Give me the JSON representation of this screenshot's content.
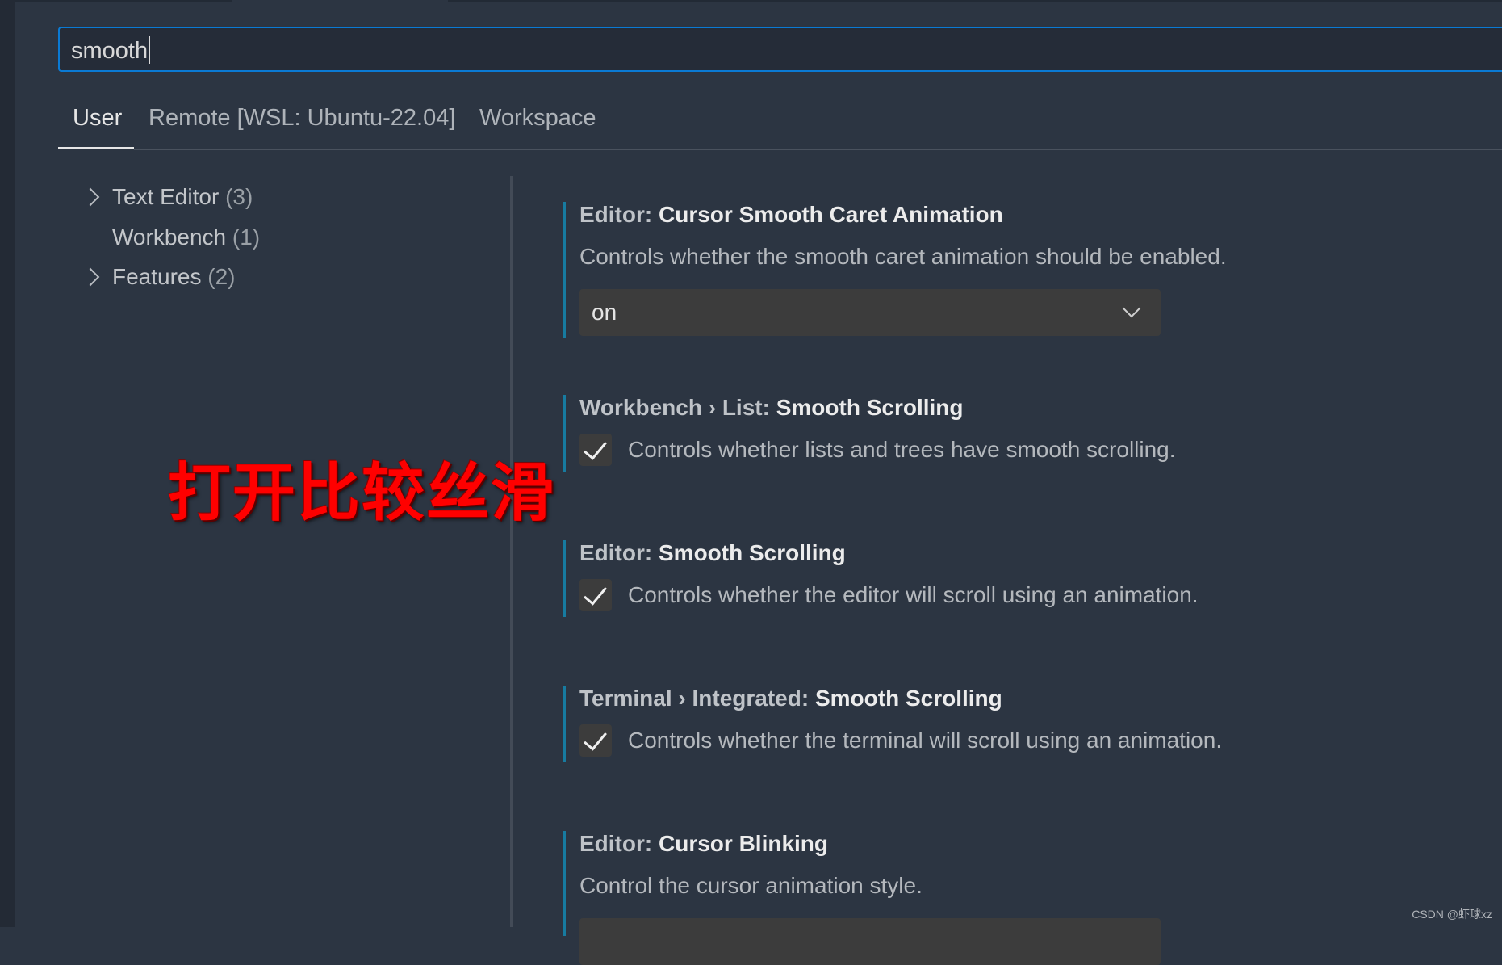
{
  "search": {
    "value": "smooth"
  },
  "tabs": [
    {
      "label": "User",
      "active": true
    },
    {
      "label": "Remote [WSL: Ubuntu-22.04]",
      "active": false
    },
    {
      "label": "Workspace",
      "active": false
    }
  ],
  "tree": [
    {
      "label": "Text Editor",
      "count": "(3)",
      "expandable": true
    },
    {
      "label": "Workbench",
      "count": "(1)",
      "expandable": false
    },
    {
      "label": "Features",
      "count": "(2)",
      "expandable": true
    }
  ],
  "settings": [
    {
      "category": "Editor: ",
      "name": "Cursor Smooth Caret Animation",
      "description": "Controls whether the smooth caret animation should be enabled.",
      "type": "dropdown",
      "value": "on"
    },
    {
      "category": "Workbench › List: ",
      "name": "Smooth Scrolling",
      "description": "Controls whether lists and trees have smooth scrolling.",
      "type": "checkbox",
      "checked": true
    },
    {
      "category": "Editor: ",
      "name": "Smooth Scrolling",
      "description": "Controls whether the editor will scroll using an animation.",
      "type": "checkbox",
      "checked": true
    },
    {
      "category": "Terminal › Integrated: ",
      "name": "Smooth Scrolling",
      "description": "Controls whether the terminal will scroll using an animation.",
      "type": "checkbox",
      "checked": true
    },
    {
      "category": "Editor: ",
      "name": "Cursor Blinking",
      "description": "Control the cursor animation style.",
      "type": "dropdown",
      "value": ""
    }
  ],
  "annotation": "打开比较丝滑",
  "watermark": "CSDN @虾球xz",
  "colors": {
    "accent": "#0a7ad4",
    "setting_bar": "#177ba0",
    "annotation": "#ff0000",
    "background": "#2c3542"
  }
}
